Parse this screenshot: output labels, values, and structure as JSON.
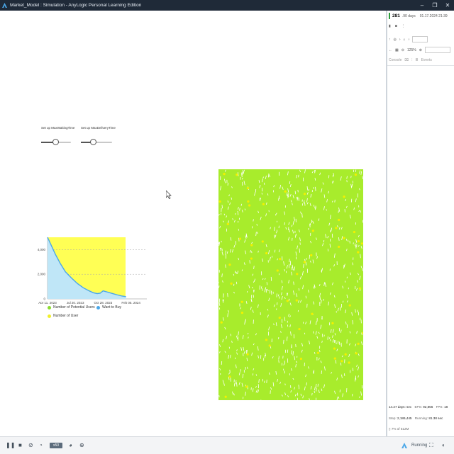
{
  "window": {
    "title": "Market_Model : Simulation - AnyLogic Personal Learning Edition"
  },
  "sliders": [
    {
      "label": "Set up MaxWaitingTime",
      "level": 0.45
    },
    {
      "label": "Set up MaxDeliveryTime",
      "level": 0.35
    }
  ],
  "chart_data": {
    "type": "area",
    "x_ticks": [
      "Apr 11, 2023",
      "Jul 20, 2023",
      "Oct 28, 2023",
      "Feb 05, 2024"
    ],
    "y_ticks": [
      "4,000",
      "2,000",
      "0"
    ],
    "ylim": [
      0,
      5000
    ],
    "x_points": [
      0,
      0.04,
      0.08,
      0.13,
      0.18,
      0.24,
      0.3,
      0.36,
      0.42,
      0.46,
      0.5,
      0.53,
      0.56,
      0.6,
      0.66,
      0.7,
      0.75,
      0.79
    ],
    "series": [
      {
        "name": "Number of Potential Users",
        "values": [
          5000,
          4350,
          3650,
          2900,
          2250,
          1750,
          1300,
          950,
          700,
          550,
          480,
          500,
          700,
          600,
          450,
          350,
          250,
          200
        ],
        "color": "#8bdc2f"
      },
      {
        "name": "Want to Buy",
        "values": [
          5000,
          4300,
          3600,
          2850,
          2200,
          1700,
          1250,
          900,
          650,
          500,
          430,
          460,
          650,
          560,
          420,
          330,
          230,
          180
        ],
        "color": "#4aa7e8"
      },
      {
        "name": "Number of User",
        "values": [
          0,
          0,
          0,
          0,
          0,
          0,
          0,
          0,
          0,
          0,
          0,
          0,
          0,
          0,
          0,
          0,
          0,
          0
        ],
        "color": "#f1ef2b"
      }
    ],
    "plot_background": "#ffff55",
    "legend": [
      "Number of Potential Users",
      "Want to Buy",
      "Number of User"
    ]
  },
  "side_panel": {
    "model_time": "281",
    "model_time_unit": ".90 days",
    "date": "01.17.2024 21:39",
    "zoom": "125%",
    "tab_console": "Console",
    "tab_events": "Events"
  },
  "stats": {
    "time_per_sec": "14.27 days: sec",
    "eps_label": "EPS:",
    "eps_value": "92,856",
    "fps_label": "FPS:",
    "fps_value": "18",
    "step_label": "Step:",
    "step_value": "2,186,445",
    "running_label": "Running:",
    "running_value": "81.38 sec",
    "memory": "7% of 512M"
  },
  "toolbar": {
    "speed_label": "x50",
    "status": "Running"
  },
  "colors": {
    "agent_green": "#a8ec2c",
    "agent_yellow": "#f4f000",
    "titlebar": "#1f2a38"
  }
}
